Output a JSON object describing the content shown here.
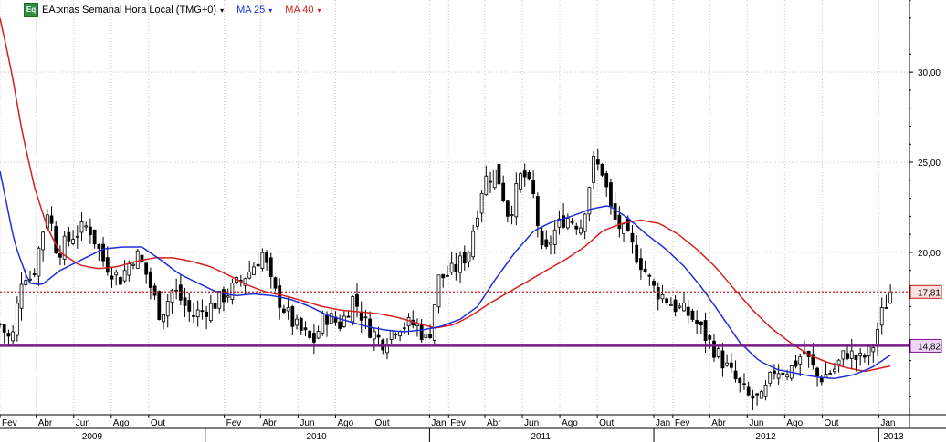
{
  "legend": {
    "icon_text": "Eq",
    "symbol_title": "EA:xnas Semanal Hora Local (TMG+0)",
    "ma25_label": "MA 25",
    "ma40_label": "MA 40",
    "caret": "▾"
  },
  "colors": {
    "candle": "#000000",
    "ma25": "#1f2fd6",
    "ma40": "#d62020",
    "support_line": "#7a1a8a",
    "resistance_line": "#c81818",
    "grid": "#c8c8c8",
    "last_price_box": "#fde0e0",
    "support_box": "#f0d6f5"
  },
  "chart_data": {
    "type": "candlestick",
    "title": "EA:xnas Semanal Hora Local (TMG+0)",
    "ylim": [
      11,
      34
    ],
    "y_ticks": [
      {
        "value": 20,
        "label": "20,00"
      },
      {
        "value": 25,
        "label": "25,00"
      },
      {
        "value": 30,
        "label": "30,00"
      }
    ],
    "x_start": "2009-02-01",
    "x_end": "2013-02-20",
    "month_ticks": [
      {
        "date": "2009-02-01",
        "label": "Fev"
      },
      {
        "date": "2009-04-01",
        "label": "Abr"
      },
      {
        "date": "2009-06-01",
        "label": "Jun"
      },
      {
        "date": "2009-08-01",
        "label": "Ago"
      },
      {
        "date": "2009-10-01",
        "label": "Out"
      },
      {
        "date": "2010-02-01",
        "label": "Fev"
      },
      {
        "date": "2010-04-01",
        "label": "Abr"
      },
      {
        "date": "2010-06-01",
        "label": "Jun"
      },
      {
        "date": "2010-08-01",
        "label": "Ago"
      },
      {
        "date": "2010-10-01",
        "label": "Out"
      },
      {
        "date": "2011-01-01",
        "label": "Jan"
      },
      {
        "date": "2011-02-01",
        "label": "Fev"
      },
      {
        "date": "2011-04-01",
        "label": "Abr"
      },
      {
        "date": "2011-06-01",
        "label": "Jun"
      },
      {
        "date": "2011-08-01",
        "label": "Ago"
      },
      {
        "date": "2011-10-01",
        "label": "Out"
      },
      {
        "date": "2012-01-01",
        "label": "Jan"
      },
      {
        "date": "2012-02-01",
        "label": "Fev"
      },
      {
        "date": "2012-04-01",
        "label": "Abr"
      },
      {
        "date": "2012-06-01",
        "label": "Jun"
      },
      {
        "date": "2012-08-01",
        "label": "Ago"
      },
      {
        "date": "2012-10-01",
        "label": "Out"
      },
      {
        "date": "2013-01-01",
        "label": "Jan"
      }
    ],
    "year_labels": [
      {
        "date": "2009-07-01",
        "label": "2009"
      },
      {
        "date": "2010-07-01",
        "label": "2010"
      },
      {
        "date": "2011-07-01",
        "label": "2011"
      },
      {
        "date": "2012-07-01",
        "label": "2012"
      },
      {
        "date": "2013-01-25",
        "label": "2013"
      }
    ],
    "year_dividers": [
      "2010-01-01",
      "2011-01-01",
      "2012-01-01",
      "2013-01-01"
    ],
    "horizontal_lines": [
      {
        "name": "last-price",
        "value": 17.81,
        "label": "17,81",
        "style": "dotted"
      },
      {
        "name": "support",
        "value": 14.82,
        "label": "14,82",
        "style": "solid"
      }
    ],
    "close_anchors": [
      [
        "2009-02-01",
        16.0
      ],
      [
        "2009-02-20",
        15.0
      ],
      [
        "2009-03-10",
        19.0
      ],
      [
        "2009-03-25",
        18.5
      ],
      [
        "2009-04-20",
        22.5
      ],
      [
        "2009-05-05",
        20.0
      ],
      [
        "2009-06-01",
        21.0
      ],
      [
        "2009-06-25",
        21.5
      ],
      [
        "2009-07-20",
        19.5
      ],
      [
        "2009-08-15",
        18.5
      ],
      [
        "2009-09-10",
        20.0
      ],
      [
        "2009-09-25",
        19.0
      ],
      [
        "2009-10-20",
        16.5
      ],
      [
        "2009-11-10",
        18.0
      ],
      [
        "2009-12-10",
        16.5
      ],
      [
        "2010-01-10",
        17.0
      ],
      [
        "2010-02-15",
        18.0
      ],
      [
        "2010-03-15",
        19.0
      ],
      [
        "2010-04-05",
        20.0
      ],
      [
        "2010-04-20",
        18.0
      ],
      [
        "2010-05-25",
        16.0
      ],
      [
        "2010-06-25",
        15.0
      ],
      [
        "2010-07-15",
        16.5
      ],
      [
        "2010-08-10",
        16.0
      ],
      [
        "2010-08-30",
        17.5
      ],
      [
        "2010-09-20",
        16.0
      ],
      [
        "2010-10-15",
        15.0
      ],
      [
        "2010-11-10",
        16.0
      ],
      [
        "2010-12-10",
        16.0
      ],
      [
        "2010-12-30",
        15.0
      ],
      [
        "2011-01-15",
        18.5
      ],
      [
        "2011-02-10",
        19.0
      ],
      [
        "2011-03-05",
        20.0
      ],
      [
        "2011-03-30",
        24.0
      ],
      [
        "2011-04-20",
        24.5
      ],
      [
        "2011-05-10",
        22.0
      ],
      [
        "2011-06-01",
        24.5
      ],
      [
        "2011-06-20",
        23.0
      ],
      [
        "2011-07-05",
        19.5
      ],
      [
        "2011-07-20",
        21.0
      ],
      [
        "2011-08-10",
        22.0
      ],
      [
        "2011-09-05",
        21.5
      ],
      [
        "2011-09-25",
        25.0
      ],
      [
        "2011-10-10",
        24.5
      ],
      [
        "2011-10-25",
        22.0
      ],
      [
        "2011-11-15",
        21.0
      ],
      [
        "2011-12-10",
        19.5
      ],
      [
        "2012-01-01",
        18.0
      ],
      [
        "2012-02-05",
        17.0
      ],
      [
        "2012-03-01",
        16.5
      ],
      [
        "2012-04-01",
        15.0
      ],
      [
        "2012-05-01",
        13.5
      ],
      [
        "2012-06-01",
        12.0
      ],
      [
        "2012-06-25",
        11.8
      ],
      [
        "2012-07-15",
        13.5
      ],
      [
        "2012-08-10",
        13.5
      ],
      [
        "2012-09-01",
        14.5
      ],
      [
        "2012-09-25",
        13.0
      ],
      [
        "2012-10-20",
        13.5
      ],
      [
        "2012-11-10",
        14.5
      ],
      [
        "2012-11-30",
        14.0
      ],
      [
        "2012-12-20",
        14.5
      ],
      [
        "2013-01-05",
        16.5
      ],
      [
        "2013-01-20",
        17.8
      ]
    ],
    "ma25_anchors": [
      [
        "2009-02-01",
        24.5
      ],
      [
        "2009-02-25",
        20.5
      ],
      [
        "2009-03-20",
        18.3
      ],
      [
        "2009-04-10",
        18.2
      ],
      [
        "2009-05-10",
        19.0
      ],
      [
        "2009-06-20",
        19.7
      ],
      [
        "2009-07-20",
        20.2
      ],
      [
        "2009-08-20",
        20.3
      ],
      [
        "2009-09-20",
        20.3
      ],
      [
        "2009-10-20",
        19.6
      ],
      [
        "2009-11-20",
        18.8
      ],
      [
        "2009-12-20",
        18.3
      ],
      [
        "2010-01-20",
        17.8
      ],
      [
        "2010-02-20",
        17.6
      ],
      [
        "2010-03-20",
        17.7
      ],
      [
        "2010-04-20",
        17.6
      ],
      [
        "2010-05-20",
        17.4
      ],
      [
        "2010-06-20",
        17.0
      ],
      [
        "2010-07-20",
        16.5
      ],
      [
        "2010-08-20",
        16.2
      ],
      [
        "2010-09-20",
        15.9
      ],
      [
        "2010-10-20",
        15.7
      ],
      [
        "2010-11-20",
        15.6
      ],
      [
        "2010-12-20",
        15.7
      ],
      [
        "2011-01-20",
        15.9
      ],
      [
        "2011-02-20",
        16.3
      ],
      [
        "2011-03-20",
        17.0
      ],
      [
        "2011-04-20",
        18.6
      ],
      [
        "2011-05-20",
        20.0
      ],
      [
        "2011-06-20",
        21.2
      ],
      [
        "2011-07-20",
        21.7
      ],
      [
        "2011-08-20",
        22.0
      ],
      [
        "2011-09-20",
        22.4
      ],
      [
        "2011-10-20",
        22.6
      ],
      [
        "2011-11-20",
        21.9
      ],
      [
        "2011-12-20",
        21.0
      ],
      [
        "2012-01-20",
        20.2
      ],
      [
        "2012-02-20",
        19.2
      ],
      [
        "2012-03-20",
        18.0
      ],
      [
        "2012-04-20",
        16.5
      ],
      [
        "2012-05-20",
        15.0
      ],
      [
        "2012-06-20",
        14.0
      ],
      [
        "2012-07-20",
        13.5
      ],
      [
        "2012-08-20",
        13.3
      ],
      [
        "2012-09-20",
        13.1
      ],
      [
        "2012-10-20",
        13.0
      ],
      [
        "2012-11-20",
        13.2
      ],
      [
        "2012-12-20",
        13.6
      ],
      [
        "2013-01-20",
        14.3
      ]
    ],
    "ma40_anchors": [
      [
        "2009-02-01",
        33.0
      ],
      [
        "2009-02-20",
        30.0
      ],
      [
        "2009-03-10",
        26.5
      ],
      [
        "2009-03-30",
        23.5
      ],
      [
        "2009-04-20",
        21.3
      ],
      [
        "2009-05-10",
        20.0
      ],
      [
        "2009-06-10",
        19.3
      ],
      [
        "2009-07-10",
        19.1
      ],
      [
        "2009-08-10",
        19.2
      ],
      [
        "2009-09-10",
        19.5
      ],
      [
        "2009-10-10",
        19.7
      ],
      [
        "2009-11-10",
        19.7
      ],
      [
        "2009-12-10",
        19.5
      ],
      [
        "2010-01-10",
        19.2
      ],
      [
        "2010-02-10",
        18.7
      ],
      [
        "2010-03-10",
        18.2
      ],
      [
        "2010-04-10",
        17.8
      ],
      [
        "2010-05-10",
        17.6
      ],
      [
        "2010-06-10",
        17.3
      ],
      [
        "2010-07-10",
        17.0
      ],
      [
        "2010-08-10",
        16.8
      ],
      [
        "2010-09-10",
        16.7
      ],
      [
        "2010-10-10",
        16.6
      ],
      [
        "2010-11-10",
        16.4
      ],
      [
        "2010-12-10",
        16.1
      ],
      [
        "2011-01-10",
        15.8
      ],
      [
        "2011-02-10",
        16.0
      ],
      [
        "2011-03-10",
        16.5
      ],
      [
        "2011-04-10",
        17.2
      ],
      [
        "2011-05-10",
        17.8
      ],
      [
        "2011-06-10",
        18.4
      ],
      [
        "2011-07-10",
        19.0
      ],
      [
        "2011-08-10",
        19.6
      ],
      [
        "2011-09-10",
        20.3
      ],
      [
        "2011-10-10",
        21.2
      ],
      [
        "2011-11-10",
        21.6
      ],
      [
        "2011-12-10",
        21.8
      ],
      [
        "2012-01-10",
        21.6
      ],
      [
        "2012-02-10",
        21.0
      ],
      [
        "2012-03-10",
        20.2
      ],
      [
        "2012-04-10",
        19.2
      ],
      [
        "2012-05-10",
        18.0
      ],
      [
        "2012-06-10",
        16.8
      ],
      [
        "2012-07-10",
        15.8
      ],
      [
        "2012-08-10",
        15.0
      ],
      [
        "2012-09-10",
        14.3
      ],
      [
        "2012-10-10",
        13.9
      ],
      [
        "2012-11-10",
        13.6
      ],
      [
        "2012-12-10",
        13.4
      ],
      [
        "2013-01-20",
        13.7
      ]
    ]
  }
}
